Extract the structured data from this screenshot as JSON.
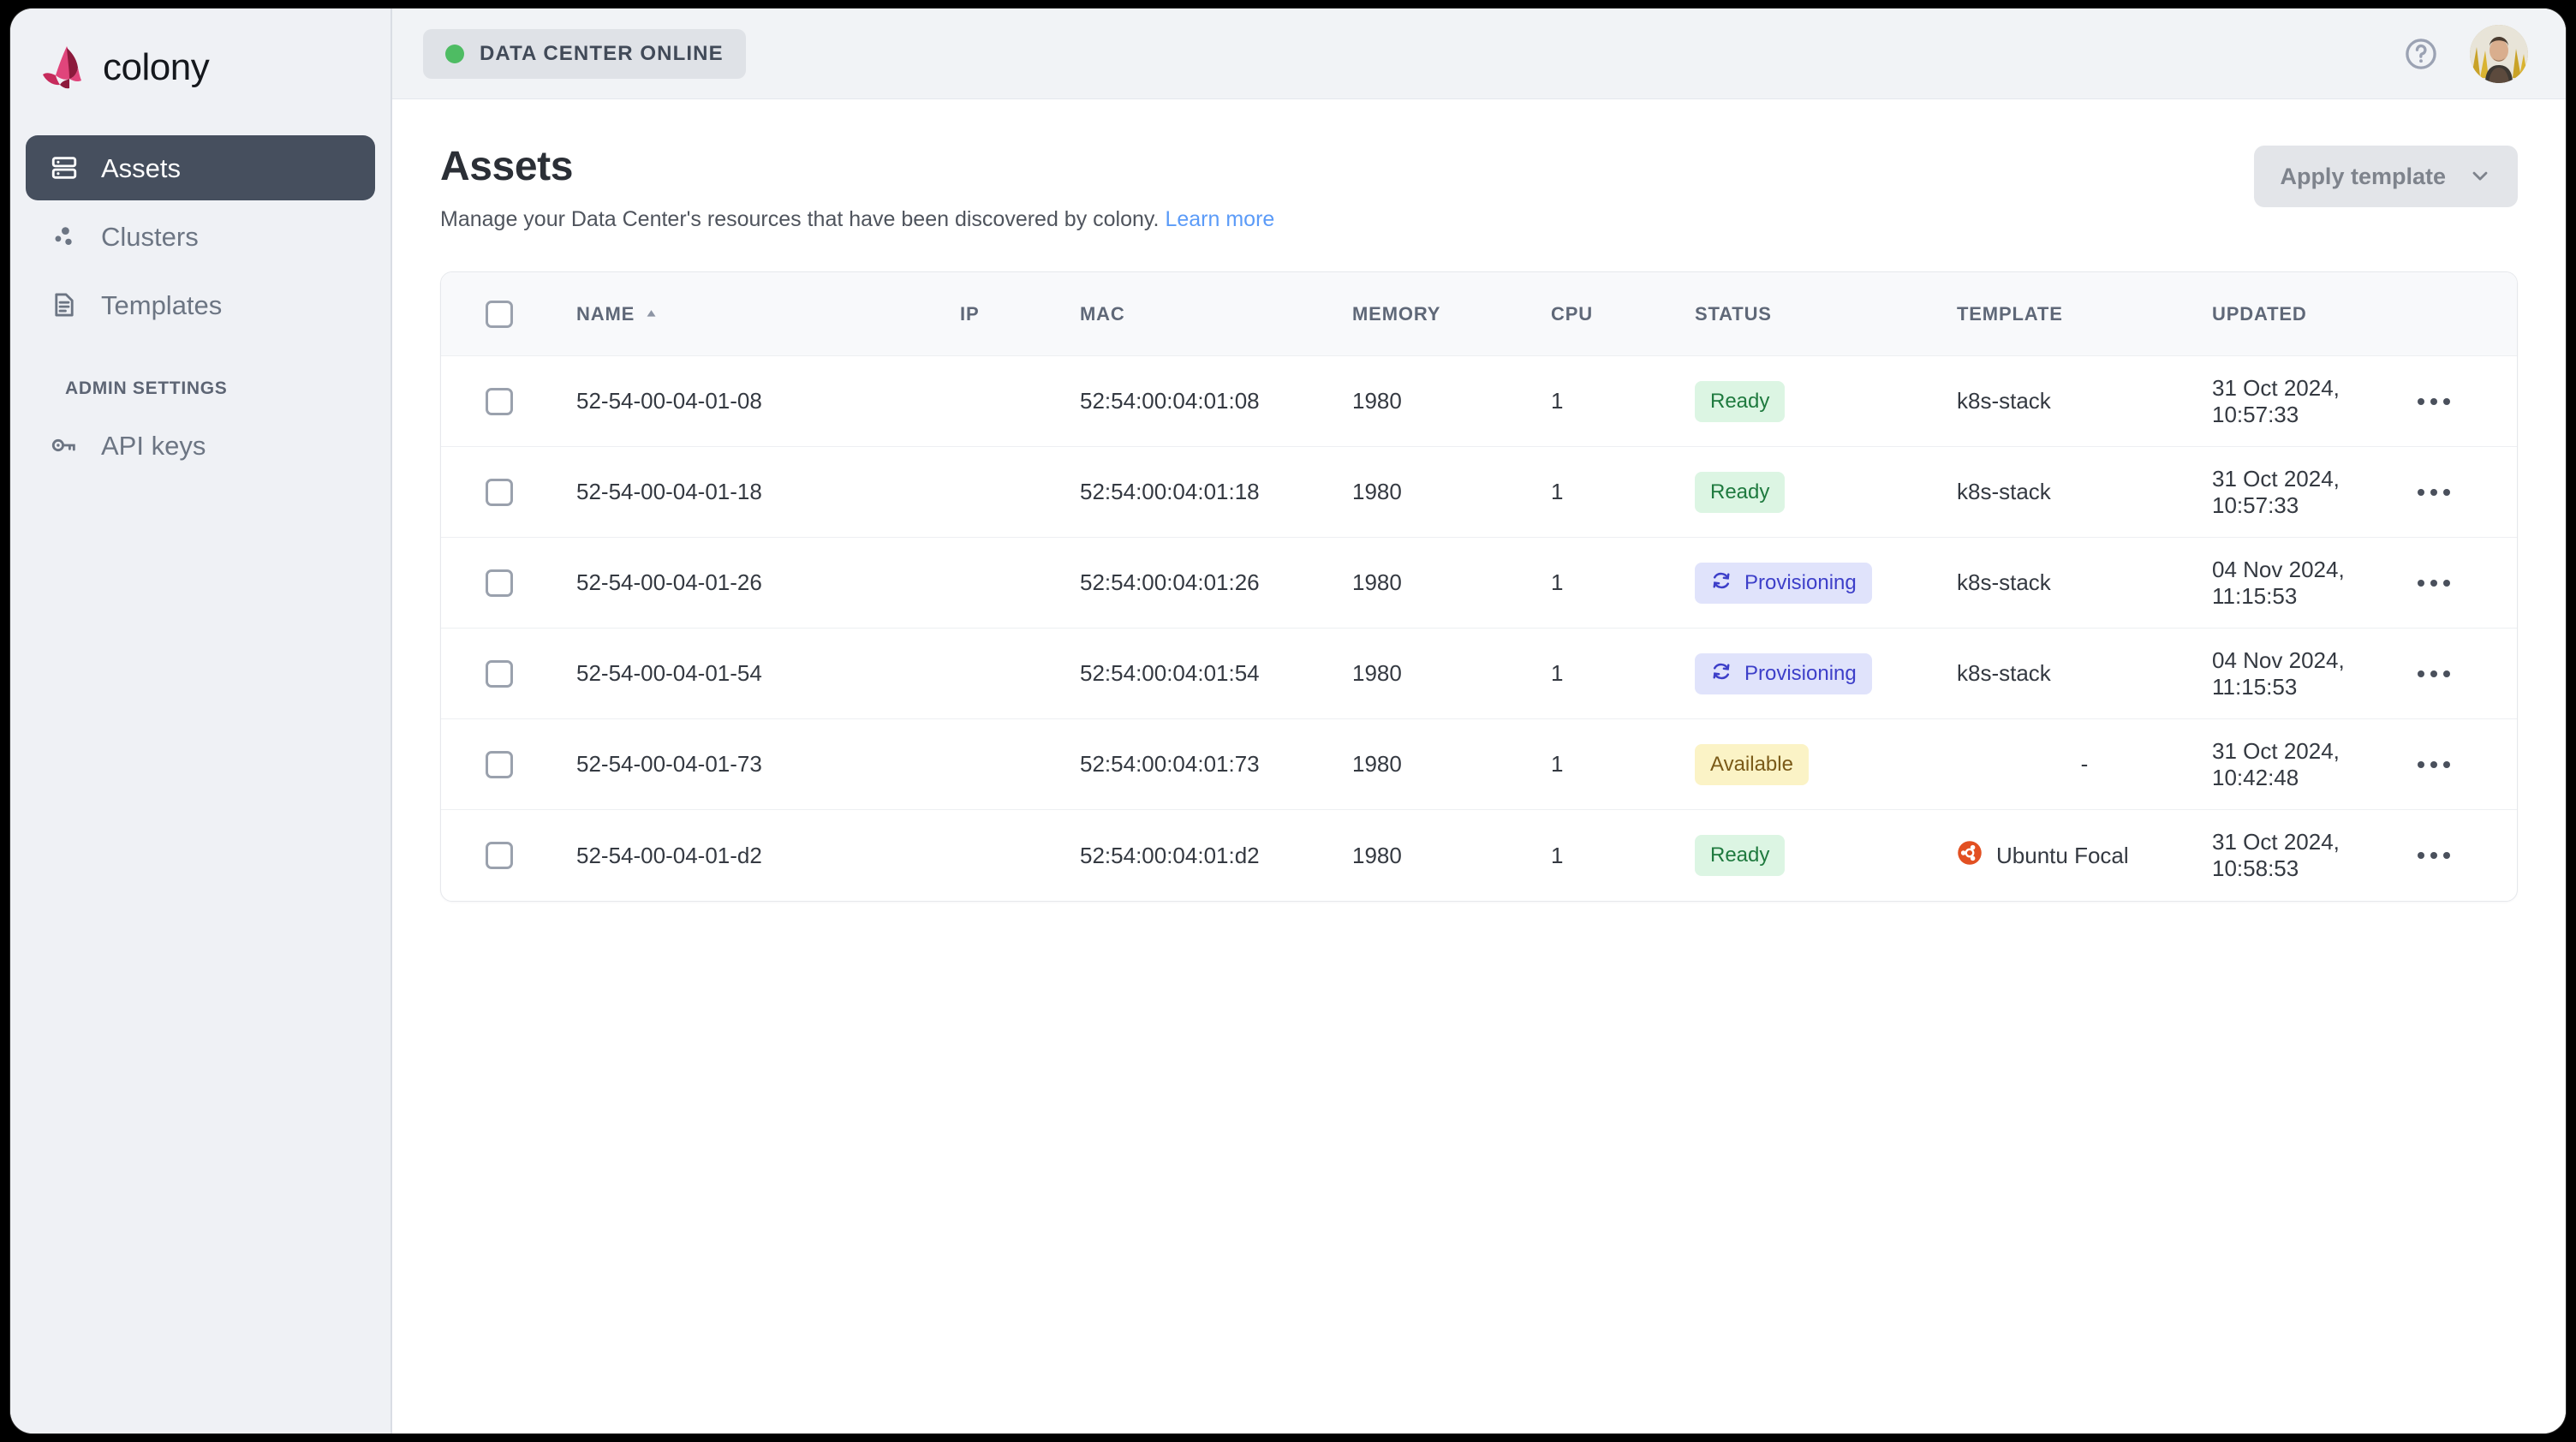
{
  "brand": {
    "name": "colony",
    "logo_icon": "colony-butterfly-logo",
    "logo_colors": [
      "#e0457b",
      "#8c1a3c",
      "#c62b5c"
    ]
  },
  "sidebar": {
    "items": [
      {
        "label": "Assets",
        "icon": "server-stack-icon",
        "active": true
      },
      {
        "label": "Clusters",
        "icon": "cluster-dots-icon",
        "active": false
      },
      {
        "label": "Templates",
        "icon": "document-icon",
        "active": false
      }
    ],
    "section_title": "ADMIN SETTINGS",
    "admin_items": [
      {
        "label": "API keys",
        "icon": "key-icon",
        "active": false
      }
    ],
    "active_bg": "#464f5e"
  },
  "topbar": {
    "status_badge": {
      "label": "DATA CENTER ONLINE",
      "dot_icon": "status-dot-icon",
      "dot_color": "#4ebc63"
    },
    "help_icon": "help-circle-icon",
    "avatar_icon": "user-avatar"
  },
  "page": {
    "title": "Assets",
    "subtitle": "Manage your Data Center's resources that have been discovered by colony.",
    "learn_more": "Learn more",
    "learn_more_color": "#5b9bf8",
    "apply_template_button": {
      "label": "Apply template",
      "icon": "chevron-down-icon",
      "disabled": true
    }
  },
  "table": {
    "select_all_icon": "checkbox-icon",
    "sort_icon": "sort-ascending-arrow-icon",
    "row_menu_icon": "ellipsis-horizontal-icon",
    "columns": [
      {
        "key": "name",
        "label": "NAME",
        "sorted": "asc"
      },
      {
        "key": "ip",
        "label": "IP"
      },
      {
        "key": "mac",
        "label": "MAC"
      },
      {
        "key": "memory",
        "label": "MEMORY"
      },
      {
        "key": "cpu",
        "label": "CPU"
      },
      {
        "key": "status",
        "label": "STATUS"
      },
      {
        "key": "template",
        "label": "TEMPLATE"
      },
      {
        "key": "updated",
        "label": "UPDATED"
      }
    ],
    "rows": [
      {
        "checked": false,
        "name": "52-54-00-04-01-08",
        "ip": "",
        "mac": "52:54:00:04:01:08",
        "memory": "1980",
        "cpu": "1",
        "status": "Ready",
        "status_kind": "ready",
        "template": "k8s-stack",
        "template_icon": "",
        "updated": "31 Oct 2024, 10:57:33"
      },
      {
        "checked": false,
        "name": "52-54-00-04-01-18",
        "ip": "",
        "mac": "52:54:00:04:01:18",
        "memory": "1980",
        "cpu": "1",
        "status": "Ready",
        "status_kind": "ready",
        "template": "k8s-stack",
        "template_icon": "",
        "updated": "31 Oct 2024, 10:57:33"
      },
      {
        "checked": false,
        "name": "52-54-00-04-01-26",
        "ip": "",
        "mac": "52:54:00:04:01:26",
        "memory": "1980",
        "cpu": "1",
        "status": "Provisioning",
        "status_kind": "provisioning",
        "template": "k8s-stack",
        "template_icon": "",
        "updated": "04 Nov 2024, 11:15:53"
      },
      {
        "checked": false,
        "name": "52-54-00-04-01-54",
        "ip": "",
        "mac": "52:54:00:04:01:54",
        "memory": "1980",
        "cpu": "1",
        "status": "Provisioning",
        "status_kind": "provisioning",
        "template": "k8s-stack",
        "template_icon": "",
        "updated": "04 Nov 2024, 11:15:53"
      },
      {
        "checked": false,
        "name": "52-54-00-04-01-73",
        "ip": "",
        "mac": "52:54:00:04:01:73",
        "memory": "1980",
        "cpu": "1",
        "status": "Available",
        "status_kind": "available",
        "template": "-",
        "template_icon": "",
        "updated": "31 Oct 2024, 10:42:48"
      },
      {
        "checked": false,
        "name": "52-54-00-04-01-d2",
        "ip": "",
        "mac": "52:54:00:04:01:d2",
        "memory": "1980",
        "cpu": "1",
        "status": "Ready",
        "status_kind": "ready",
        "template": "Ubuntu Focal",
        "template_icon": "ubuntu-logo-icon",
        "updated": "31 Oct 2024, 10:58:53"
      }
    ]
  },
  "colors": {
    "ready_bg": "#dcf5e3",
    "ready_fg": "#1f7a3f",
    "provisioning_bg": "#e0e3fb",
    "provisioning_fg": "#3d3fc9",
    "available_bg": "#fbf3c6",
    "available_fg": "#7a5a18",
    "ubuntu_orange": "#e25022"
  }
}
